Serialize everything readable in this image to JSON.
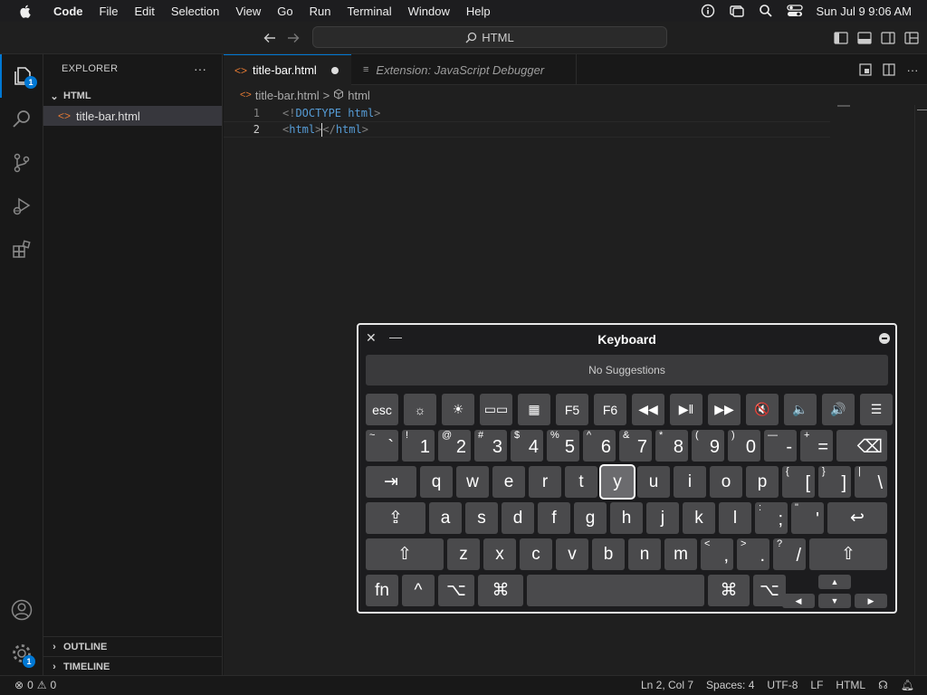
{
  "menubar": {
    "app": "Code",
    "items": [
      "File",
      "Edit",
      "Selection",
      "View",
      "Go",
      "Run",
      "Terminal",
      "Window",
      "Help"
    ],
    "clock": "Sun Jul 9  9:06 AM"
  },
  "titlebar": {
    "search": "HTML"
  },
  "activity": {
    "explorer_badge": "1",
    "settings_badge": "1"
  },
  "sidebar": {
    "title": "EXPLORER",
    "more": "···",
    "folder": "HTML",
    "file": "title-bar.html",
    "outline": "OUTLINE",
    "timeline": "TIMELINE"
  },
  "tabs": [
    {
      "label": "title-bar.html"
    },
    {
      "label": "Extension: JavaScript Debugger"
    }
  ],
  "breadcrumb": {
    "file": "title-bar.html",
    "sep": ">",
    "symbol": "html"
  },
  "code": {
    "lines": [
      {
        "num": "1",
        "open": "<!",
        "name": "DOCTYPE",
        "sp": " ",
        "attr": "html",
        "close": ">"
      },
      {
        "num": "2",
        "a": "<",
        "b": "html",
        "c": ">",
        "d": "</",
        "e": "html",
        "f": ">"
      }
    ]
  },
  "statusbar": {
    "errors": "0",
    "warnings": "0",
    "position": "Ln 2, Col 7",
    "spaces": "Spaces: 4",
    "encoding": "UTF-8",
    "eol": "LF",
    "language": "HTML"
  },
  "keyboard": {
    "title": "Keyboard",
    "suggestions": "No Suggestions",
    "row0": [
      "esc",
      "☼",
      "☀",
      "▭▭",
      "▦",
      "F5",
      "F6",
      "◀◀",
      "▶‖",
      "▶▶",
      "🔇",
      "🔈",
      "🔊",
      "☰"
    ],
    "row1": [
      [
        "~",
        "`"
      ],
      [
        "!",
        "1"
      ],
      [
        "@",
        "2"
      ],
      [
        "#",
        "3"
      ],
      [
        "$",
        "4"
      ],
      [
        "%",
        "5"
      ],
      [
        "^",
        "6"
      ],
      [
        "&",
        "7"
      ],
      [
        "*",
        "8"
      ],
      [
        "(",
        "9"
      ],
      [
        ")",
        "0"
      ],
      [
        "—",
        "-"
      ],
      [
        "+",
        "="
      ],
      [
        "",
        "⌫"
      ]
    ],
    "row2": [
      "⇥",
      "q",
      "w",
      "e",
      "r",
      "t",
      "y",
      "u",
      "i",
      "o",
      "p",
      [
        "{",
        "["
      ],
      [
        "}",
        "]"
      ],
      [
        "|",
        "\\"
      ]
    ],
    "row3": [
      "⇪",
      "a",
      "s",
      "d",
      "f",
      "g",
      "h",
      "j",
      "k",
      "l",
      [
        ":",
        ";"
      ],
      [
        "\"",
        "'"
      ],
      "↩"
    ],
    "row4": [
      "⇧",
      "z",
      "x",
      "c",
      "v",
      "b",
      "n",
      "m",
      [
        "<",
        ","
      ],
      [
        ">",
        "."
      ],
      [
        "?",
        "/"
      ],
      "⇧"
    ],
    "row5": [
      "fn",
      "^",
      "⌥",
      "⌘",
      "",
      "⌘",
      "⌥"
    ],
    "arrows": [
      "▲",
      "◀",
      "▼",
      "▶"
    ]
  },
  "colors": {
    "accent": "#0078d4",
    "fileicon": "#e37933"
  }
}
